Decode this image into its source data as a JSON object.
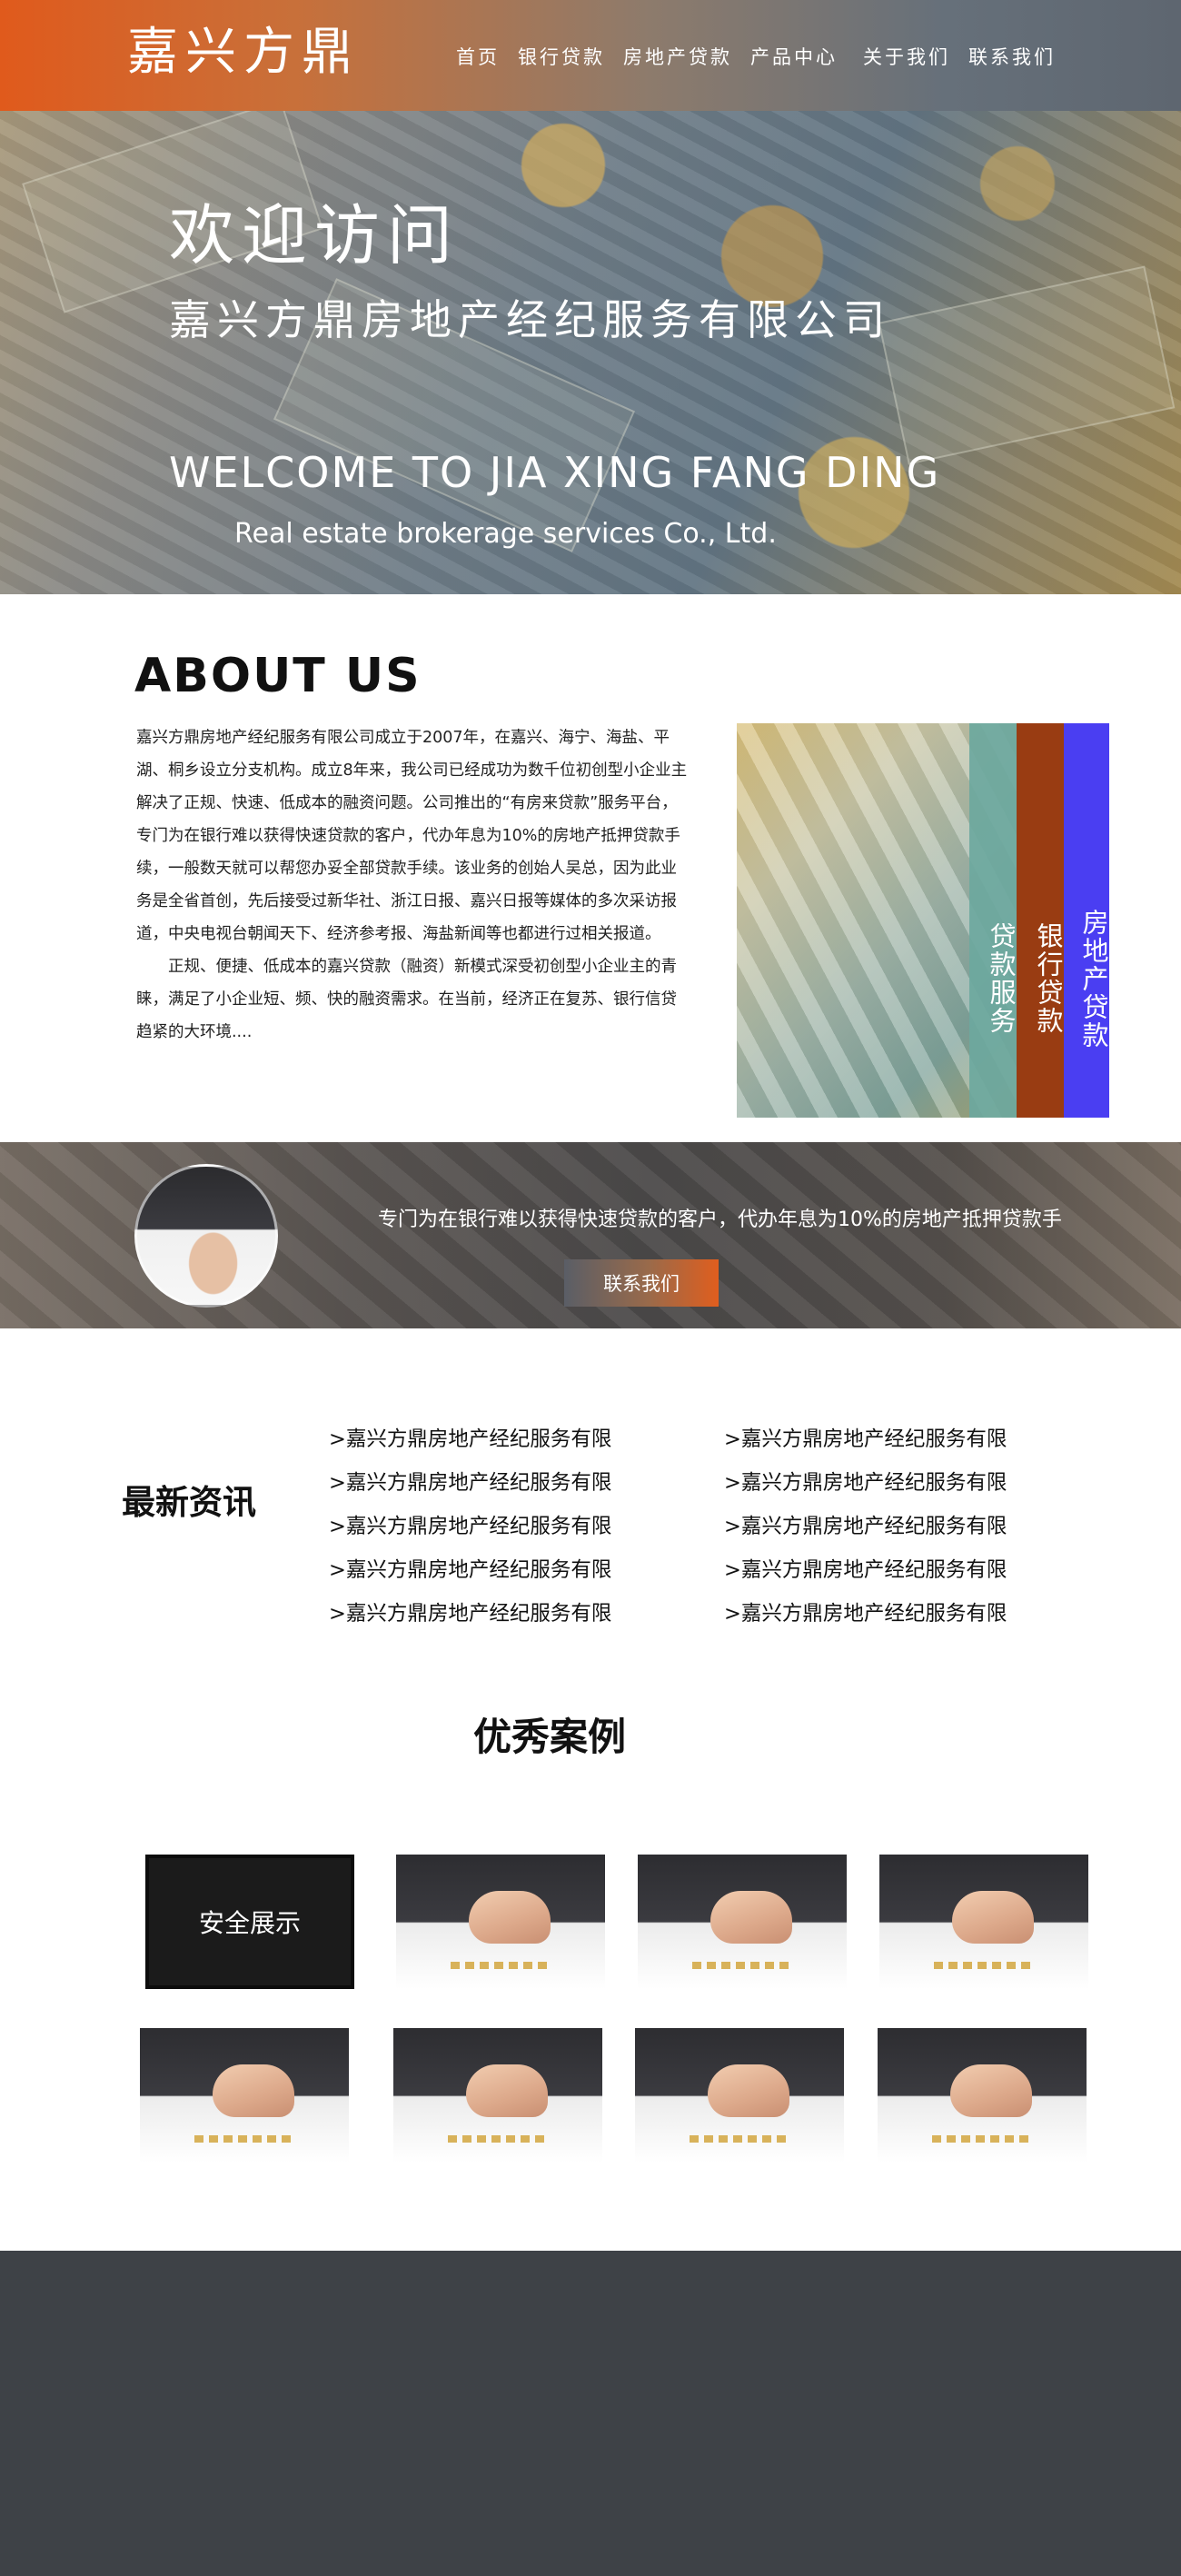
{
  "header": {
    "logo": "嘉兴方鼎",
    "nav": [
      "首页",
      "银行贷款",
      "房地产贷款",
      "产品中心",
      "关于我们",
      "联系我们"
    ]
  },
  "hero": {
    "title": "欢迎访问",
    "company": "嘉兴方鼎房地产经纪服务有限公司",
    "english_title": "WELCOME TO JIA XING FANG DING",
    "english_subtitle": "Real estate brokerage services Co., Ltd."
  },
  "about": {
    "title": "ABOUT US",
    "paragraph1": "嘉兴方鼎房地产经纪服务有限公司成立于2007年，在嘉兴、海宁、海盐、平湖、桐乡设立分支机构。成立8年来，我公司已经成功为数千位初创型小企业主解决了正规、快速、低成本的融资问题。公司推出的“有房来贷款”服务平台，专门为在银行难以获得快速贷款的客户，代办年息为10%的房地产抵押贷款手续，一般数天就可以帮您办妥全部贷款手续。该业务的创始人吴总，因为此业务是全省首创，先后接受过新华社、浙江日报、嘉兴日报等媒体的多次采访报道，中央电视台朝闻天下、经济参考报、海盐新闻等也都进行过相关报道。",
    "paragraph2": "正规、便捷、低成本的嘉兴贷款（融资）新模式深受初创型小企业主的青睐，满足了小企业短、频、快的融资需求。在当前，经济正在复苏、银行信贷趋紧的大环境....",
    "tags": [
      "贷款服务",
      "银行贷款",
      "房地产贷款"
    ]
  },
  "banner": {
    "text": "专门为在银行难以获得快速贷款的客户，代办年息为10%的房地产抵押贷款手",
    "button": "联系我们"
  },
  "news": {
    "title": "最新资讯",
    "left_items": [
      ">嘉兴方鼎房地产经纪服务有限",
      ">嘉兴方鼎房地产经纪服务有限",
      ">嘉兴方鼎房地产经纪服务有限",
      ">嘉兴方鼎房地产经纪服务有限",
      ">嘉兴方鼎房地产经纪服务有限"
    ],
    "right_items": [
      ">嘉兴方鼎房地产经纪服务有限",
      ">嘉兴方鼎房地产经纪服务有限",
      ">嘉兴方鼎房地产经纪服务有限",
      ">嘉兴方鼎房地产经纪服务有限",
      ">嘉兴方鼎房地产经纪服务有限"
    ]
  },
  "cases": {
    "title": "优秀案例",
    "feature_label": "安全展示"
  },
  "colors": {
    "header_orange": "#e05a1c",
    "tag_teal": "#6ca89e",
    "tag_brown": "#993c12",
    "tag_blue": "#4a3ef2",
    "footer": "#3e4247"
  }
}
